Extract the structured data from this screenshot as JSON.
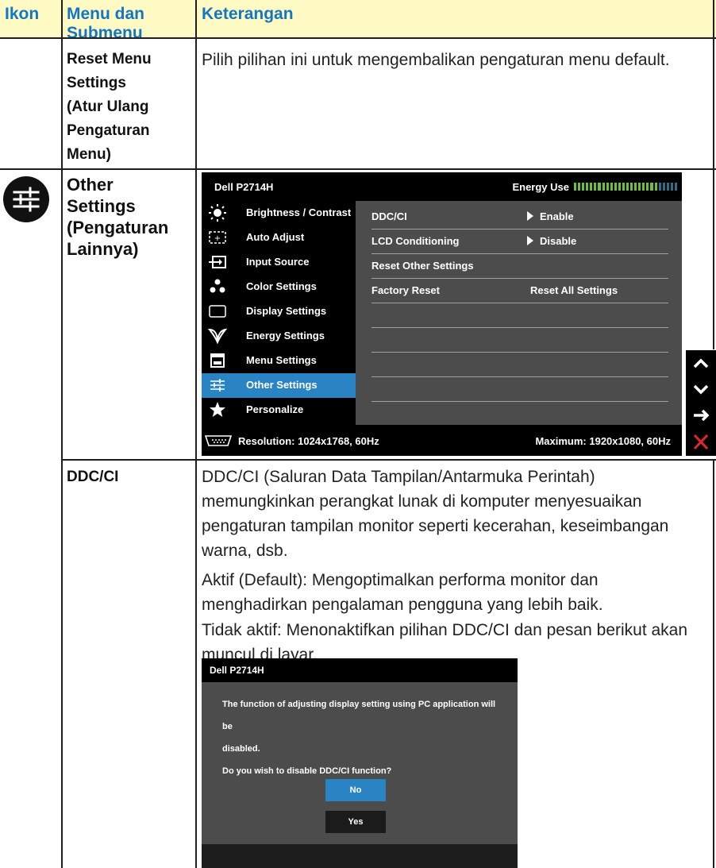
{
  "table_header": {
    "col_icon": "Ikon",
    "col_menu": "Menu dan Submenu",
    "col_desc": "Keterangan"
  },
  "row_reset": {
    "menu_lines": [
      "Reset Menu",
      "Settings",
      "(Atur Ulang",
      "Pengaturan",
      "Menu)"
    ],
    "desc": "Pilih pilihan ini untuk mengembalikan pengaturan menu default."
  },
  "row_other": {
    "icon": "sliders-icon",
    "menu_lines": [
      "Other",
      "Settings",
      "(Pengaturan",
      "Lainnya)"
    ]
  },
  "osd": {
    "title": "Dell P2714H",
    "energy_label": "Energy Use",
    "energy_level": 0.8,
    "menu_items": [
      {
        "icon": "brightness-icon",
        "label": "Brightness / Contrast"
      },
      {
        "icon": "auto-adjust-icon",
        "label": "Auto Adjust"
      },
      {
        "icon": "input-source-icon",
        "label": "Input Source"
      },
      {
        "icon": "color-settings-icon",
        "label": "Color Settings"
      },
      {
        "icon": "display-settings-icon",
        "label": "Display Settings"
      },
      {
        "icon": "energy-settings-icon",
        "label": "Energy Settings"
      },
      {
        "icon": "menu-settings-icon",
        "label": "Menu Settings"
      },
      {
        "icon": "other-settings-icon",
        "label": "Other Settings"
      },
      {
        "icon": "star-icon",
        "label": "Personalize"
      }
    ],
    "selected_item": "Other Settings",
    "settings": [
      {
        "label": "DDC/CI",
        "value": "Enable"
      },
      {
        "label": "LCD Conditioning",
        "value": "Disable"
      },
      {
        "label": "Reset Other Settings",
        "value": ""
      },
      {
        "label": "Factory Reset",
        "value": "Reset All Settings"
      }
    ],
    "resolution": "Resolution: 1024x1768, 60Hz",
    "maximum": "Maximum: 1920x1080, 60Hz",
    "nav_buttons": [
      {
        "icon": "up-arrow-icon",
        "glyph": "^"
      },
      {
        "icon": "down-arrow-icon",
        "glyph": "v"
      },
      {
        "icon": "right-arrow-icon",
        "glyph": "→"
      },
      {
        "icon": "close-icon",
        "glyph": "✕"
      }
    ],
    "colors": {
      "selected": "#2a84c4",
      "close": "#e3262b",
      "panel": "#4c4c4c"
    }
  },
  "row_ddc": {
    "menu": "DDC/CI",
    "para1": "DDC/CI (Saluran Data Tampilan/Antarmuka Perintah) memungkinkan perangkat lunak di komputer menyesuaikan pengaturan tampilan monitor seperti kecerahan, keseimbangan warna, dsb.",
    "para2": "Aktif (Default): Mengoptimalkan performa monitor dan menghadirkan pengalaman pengguna yang lebih baik.",
    "para3": "Tidak aktif: Menonaktifkan pilihan DDC/CI dan pesan berikut akan muncul di layar."
  },
  "dialog": {
    "title": "Dell P2714H",
    "message_line1": "The function of adjusting display setting using PC application will be",
    "message_line2": "disabled.",
    "question": "Do you wish to disable DDC/CI function?",
    "btn_no": "No",
    "btn_yes": "Yes"
  },
  "colors": {
    "header_bg": "#fffac4",
    "header_text": "#1376c5"
  }
}
